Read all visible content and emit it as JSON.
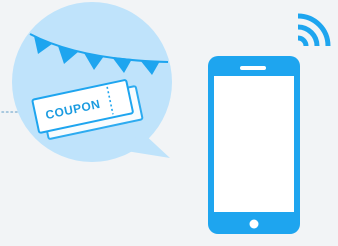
{
  "coupon": {
    "label": "COUPON"
  },
  "colors": {
    "background": "#f2f4f6",
    "bubble": "#bfe3fb",
    "accent": "#1ea5ef",
    "ticket_fill": "#ffffff",
    "phone_screen": "#ffffff"
  },
  "icons": {
    "bunting": "bunting-flags-icon",
    "coupon": "coupon-ticket-icon",
    "phone": "smartphone-icon",
    "signal": "wireless-signal-icon"
  }
}
